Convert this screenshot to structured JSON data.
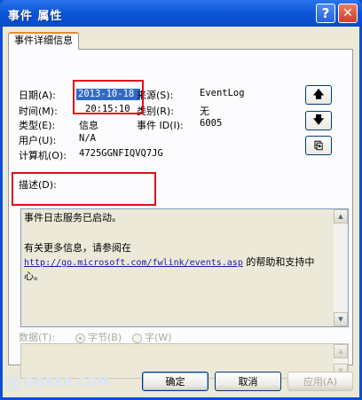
{
  "window": {
    "title": "事件 属性",
    "help_glyph": "?",
    "close_glyph": "✕"
  },
  "tab": {
    "label": "事件详细信息"
  },
  "fields": {
    "date_label": "日期(A):",
    "date_value": "2013-10-18",
    "time_label": "时间(M):",
    "time_value": "20:15:10",
    "type_label": "类型(E):",
    "type_value": "信息",
    "user_label": "用户(U):",
    "user_value": "N/A",
    "computer_label": "计算机(O):",
    "computer_value": "4725GGNFIQVQ7JG",
    "source_label": "来源(S):",
    "source_value": "EventLog",
    "category_label": "类别(R):",
    "category_value": "无",
    "event_id_label": "事件 ID(I):",
    "event_id_value": "6005"
  },
  "side_buttons": {
    "up_glyph": "🡅",
    "down_glyph": "🡇",
    "copy_glyph": "⎘"
  },
  "description": {
    "label": "描述(D):",
    "line1": "事件日志服务已启动。",
    "line2": "有关更多信息，请参阅在",
    "link": "http://go.microsoft.com/fwlink/events.asp",
    "line3_suffix": " 的帮助和支持中",
    "line4": "心。"
  },
  "data_section": {
    "label": "数据(T):",
    "radio_bytes": "字节(B)",
    "radio_words": "字(W)"
  },
  "buttons": {
    "ok": "确定",
    "cancel": "取消",
    "apply": "应用(A)"
  },
  "watermark": {
    "circle": "@",
    "text": "QQ880.COM"
  },
  "colors": {
    "title_bar": "#0a4fd6",
    "dialog_bg": "#ece9d8",
    "highlight": "#e0101a",
    "selection": "#316ac5",
    "link": "#1a1aa6"
  }
}
